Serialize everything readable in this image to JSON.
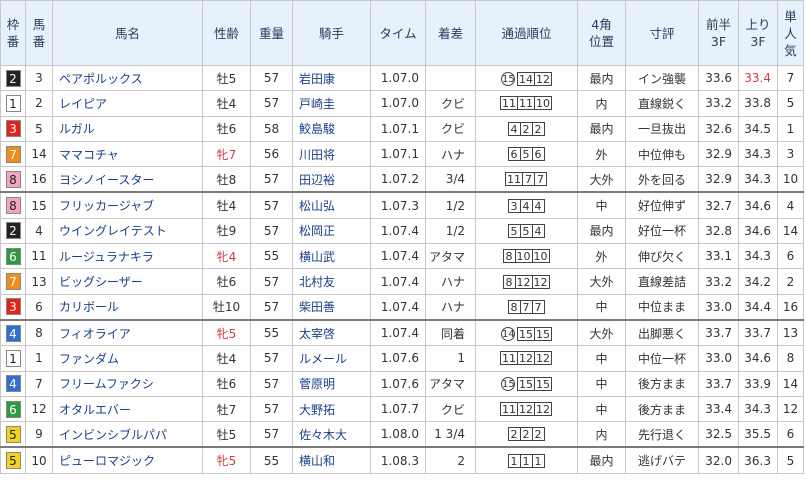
{
  "headers": [
    "枠番",
    "馬番",
    "馬名",
    "性齢",
    "重量",
    "騎手",
    "タイム",
    "着差",
    "通過順位",
    "4角位置",
    "寸評",
    "前半3F",
    "上り3F",
    "単人気"
  ],
  "header_lines": {
    "waku": [
      "枠",
      "番"
    ],
    "umaban": [
      "馬",
      "番"
    ],
    "corner": [
      "4角",
      "位置"
    ],
    "front": [
      "前半",
      "3F"
    ],
    "last": [
      "上り",
      "3F"
    ],
    "pop": [
      "単",
      "人",
      "気"
    ]
  },
  "rows": [
    {
      "waku": "2",
      "umaban": "3",
      "name": "ペアポルックス",
      "sexage": "牡5",
      "female": false,
      "weight": "57",
      "jockey": "岩田康",
      "time": "1.07.0",
      "margin": "",
      "pos": {
        "circle": "15",
        "boxes": [
          "14",
          "12"
        ]
      },
      "corner": "最内",
      "comment": "イン強襲",
      "front": "33.6",
      "last": "33.4",
      "last_hl": true,
      "pop": "7"
    },
    {
      "waku": "1",
      "umaban": "2",
      "name": "レイピア",
      "sexage": "牡4",
      "female": false,
      "weight": "57",
      "jockey": "戸崎圭",
      "time": "1.07.0",
      "margin": "クビ",
      "pos": {
        "circle": "",
        "boxes": [
          "11",
          "11",
          "10"
        ]
      },
      "corner": "内",
      "comment": "直線鋭く",
      "front": "33.2",
      "last": "33.8",
      "last_hl": false,
      "pop": "5"
    },
    {
      "waku": "3",
      "umaban": "5",
      "name": "ルガル",
      "sexage": "牡6",
      "female": false,
      "weight": "58",
      "jockey": "鮫島駿",
      "time": "1.07.1",
      "margin": "クビ",
      "pos": {
        "circle": "",
        "boxes": [
          "4",
          "2",
          "2"
        ]
      },
      "corner": "最内",
      "comment": "一旦抜出",
      "front": "32.6",
      "last": "34.5",
      "last_hl": false,
      "pop": "1"
    },
    {
      "waku": "7",
      "umaban": "14",
      "name": "ママコチャ",
      "sexage": "牝7",
      "female": true,
      "weight": "56",
      "jockey": "川田将",
      "time": "1.07.1",
      "margin": "ハナ",
      "pos": {
        "circle": "",
        "boxes": [
          "6",
          "5",
          "6"
        ]
      },
      "corner": "外",
      "comment": "中位伸も",
      "front": "32.9",
      "last": "34.3",
      "last_hl": false,
      "pop": "3"
    },
    {
      "waku": "8",
      "umaban": "16",
      "name": "ヨシノイースター",
      "sexage": "牡8",
      "female": false,
      "weight": "57",
      "jockey": "田辺裕",
      "time": "1.07.2",
      "margin": "3/4",
      "pos": {
        "circle": "",
        "boxes": [
          "11",
          "7",
          "7"
        ]
      },
      "corner": "大外",
      "comment": "外を回る",
      "front": "32.9",
      "last": "34.3",
      "last_hl": false,
      "pop": "10"
    },
    {
      "waku": "8",
      "umaban": "15",
      "name": "フリッカージャブ",
      "sexage": "牡4",
      "female": false,
      "weight": "57",
      "jockey": "松山弘",
      "time": "1.07.3",
      "margin": "1/2",
      "pos": {
        "circle": "",
        "boxes": [
          "3",
          "4",
          "4"
        ]
      },
      "corner": "中",
      "comment": "好位伸ず",
      "front": "32.7",
      "last": "34.6",
      "last_hl": false,
      "pop": "4"
    },
    {
      "waku": "2",
      "umaban": "4",
      "name": "ウイングレイテスト",
      "sexage": "牡9",
      "female": false,
      "weight": "57",
      "jockey": "松岡正",
      "time": "1.07.4",
      "margin": "1/2",
      "pos": {
        "circle": "",
        "boxes": [
          "5",
          "5",
          "4"
        ]
      },
      "corner": "最内",
      "comment": "好位一杯",
      "front": "32.8",
      "last": "34.6",
      "last_hl": false,
      "pop": "14"
    },
    {
      "waku": "6",
      "umaban": "11",
      "name": "ルージュラナキラ",
      "sexage": "牝4",
      "female": true,
      "weight": "55",
      "jockey": "横山武",
      "time": "1.07.4",
      "margin": "アタマ",
      "pos": {
        "circle": "",
        "boxes": [
          "8",
          "10",
          "10"
        ]
      },
      "corner": "外",
      "comment": "伸び欠く",
      "front": "33.1",
      "last": "34.3",
      "last_hl": false,
      "pop": "6"
    },
    {
      "waku": "7",
      "umaban": "13",
      "name": "ビッグシーザー",
      "sexage": "牡6",
      "female": false,
      "weight": "57",
      "jockey": "北村友",
      "time": "1.07.4",
      "margin": "ハナ",
      "pos": {
        "circle": "",
        "boxes": [
          "8",
          "12",
          "12"
        ]
      },
      "corner": "大外",
      "comment": "直線差詰",
      "front": "33.2",
      "last": "34.2",
      "last_hl": false,
      "pop": "2"
    },
    {
      "waku": "3",
      "umaban": "6",
      "name": "カリボール",
      "sexage": "牡10",
      "female": false,
      "weight": "57",
      "jockey": "柴田善",
      "time": "1.07.4",
      "margin": "ハナ",
      "pos": {
        "circle": "",
        "boxes": [
          "8",
          "7",
          "7"
        ]
      },
      "corner": "中",
      "comment": "中位まま",
      "front": "33.0",
      "last": "34.4",
      "last_hl": false,
      "pop": "16"
    },
    {
      "waku": "4",
      "umaban": "8",
      "name": "フィオライア",
      "sexage": "牝5",
      "female": true,
      "weight": "55",
      "jockey": "太宰啓",
      "time": "1.07.4",
      "margin": "同着",
      "pos": {
        "circle": "14",
        "boxes": [
          "15",
          "15"
        ]
      },
      "corner": "大外",
      "comment": "出脚悪く",
      "front": "33.7",
      "last": "33.7",
      "last_hl": false,
      "pop": "13"
    },
    {
      "waku": "1",
      "umaban": "1",
      "name": "ファンダム",
      "sexage": "牡4",
      "female": false,
      "weight": "57",
      "jockey": "ルメール",
      "time": "1.07.6",
      "margin": "1",
      "pos": {
        "circle": "",
        "boxes": [
          "11",
          "12",
          "12"
        ]
      },
      "corner": "中",
      "comment": "中位一杯",
      "front": "33.0",
      "last": "34.6",
      "last_hl": false,
      "pop": "8"
    },
    {
      "waku": "4",
      "umaban": "7",
      "name": "フリームファクシ",
      "sexage": "牡6",
      "female": false,
      "weight": "57",
      "jockey": "菅原明",
      "time": "1.07.6",
      "margin": "アタマ",
      "pos": {
        "circle": "15",
        "boxes": [
          "15",
          "15"
        ]
      },
      "corner": "中",
      "comment": "後方まま",
      "front": "33.7",
      "last": "33.9",
      "last_hl": false,
      "pop": "14"
    },
    {
      "waku": "6",
      "umaban": "12",
      "name": "オタルエバー",
      "sexage": "牡7",
      "female": false,
      "weight": "57",
      "jockey": "大野拓",
      "time": "1.07.7",
      "margin": "クビ",
      "pos": {
        "circle": "",
        "boxes": [
          "11",
          "12",
          "12"
        ]
      },
      "corner": "中",
      "comment": "後方まま",
      "front": "33.4",
      "last": "34.3",
      "last_hl": false,
      "pop": "12"
    },
    {
      "waku": "5",
      "umaban": "9",
      "name": "インビンシブルパパ",
      "sexage": "牡5",
      "female": false,
      "weight": "57",
      "jockey": "佐々木大",
      "time": "1.08.0",
      "margin": "1 3/4",
      "pos": {
        "circle": "",
        "boxes": [
          "2",
          "2",
          "2"
        ]
      },
      "corner": "内",
      "comment": "先行退く",
      "front": "32.5",
      "last": "35.5",
      "last_hl": false,
      "pop": "6"
    },
    {
      "waku": "5",
      "umaban": "10",
      "name": "ピューロマジック",
      "sexage": "牝5",
      "female": true,
      "weight": "55",
      "jockey": "横山和",
      "time": "1.08.3",
      "margin": "2",
      "pos": {
        "circle": "",
        "boxes": [
          "1",
          "1",
          "1"
        ]
      },
      "corner": "最内",
      "comment": "逃げバテ",
      "front": "32.0",
      "last": "36.3",
      "last_hl": false,
      "pop": "5"
    }
  ],
  "waku_colors": {
    "1": {
      "bg": "#ffffff",
      "fg": "#222222"
    },
    "2": {
      "bg": "#222222",
      "fg": "#ffffff"
    },
    "3": {
      "bg": "#e2231a",
      "fg": "#ffffff"
    },
    "4": {
      "bg": "#2e6fd0",
      "fg": "#ffffff"
    },
    "5": {
      "bg": "#f2d21b",
      "fg": "#222222"
    },
    "6": {
      "bg": "#2e9a3f",
      "fg": "#ffffff"
    },
    "7": {
      "bg": "#f08c1a",
      "fg": "#ffffff"
    },
    "8": {
      "bg": "#f2a4c2",
      "fg": "#222222"
    }
  },
  "separator_after": [
    4,
    9,
    14
  ],
  "colors": {
    "header_bg": "#e6f1fb",
    "link": "#1a3f8a",
    "female": "#d03a4a",
    "highlight": "#d03a4a"
  }
}
